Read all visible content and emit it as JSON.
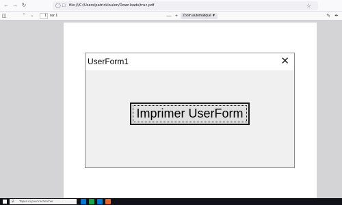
{
  "browser": {
    "url": "file:///C:/Users/patrickloulon/Downloads/truc.pdf",
    "icons": {
      "back": "arrow-left-icon",
      "forward": "arrow-right-icon",
      "reload": "reload-icon",
      "shield": "shield-icon",
      "file": "file-icon",
      "bookmark": "star-icon"
    }
  },
  "pdf_toolbar": {
    "page_number": "1",
    "page_count": "sur 1",
    "zoom_minus": "—",
    "zoom_plus": "+",
    "zoom_value": "Zoom automatique",
    "icons": {
      "sidebar": "sidebar-toggle-icon",
      "prev": "chevron-up-icon",
      "next": "chevron-down-icon",
      "caret": "chevron-down-icon",
      "draw": "draw-icon",
      "edit": "pen-icon"
    }
  },
  "userform": {
    "title": "UserForm1",
    "close_glyph": "✕",
    "button_label": "Imprimer UserForm"
  },
  "taskbar": {
    "search_placeholder": "Taper ici pour rechercher",
    "colors": {
      "background": "#101218",
      "app_blue": "#0078d4",
      "app_green": "#16a34a",
      "app_orange": "#e0662a"
    }
  },
  "colors": {
    "viewer_background": "#d4d4d7",
    "form_background": "#f0f0f0",
    "button_face": "#e1e1e1"
  }
}
